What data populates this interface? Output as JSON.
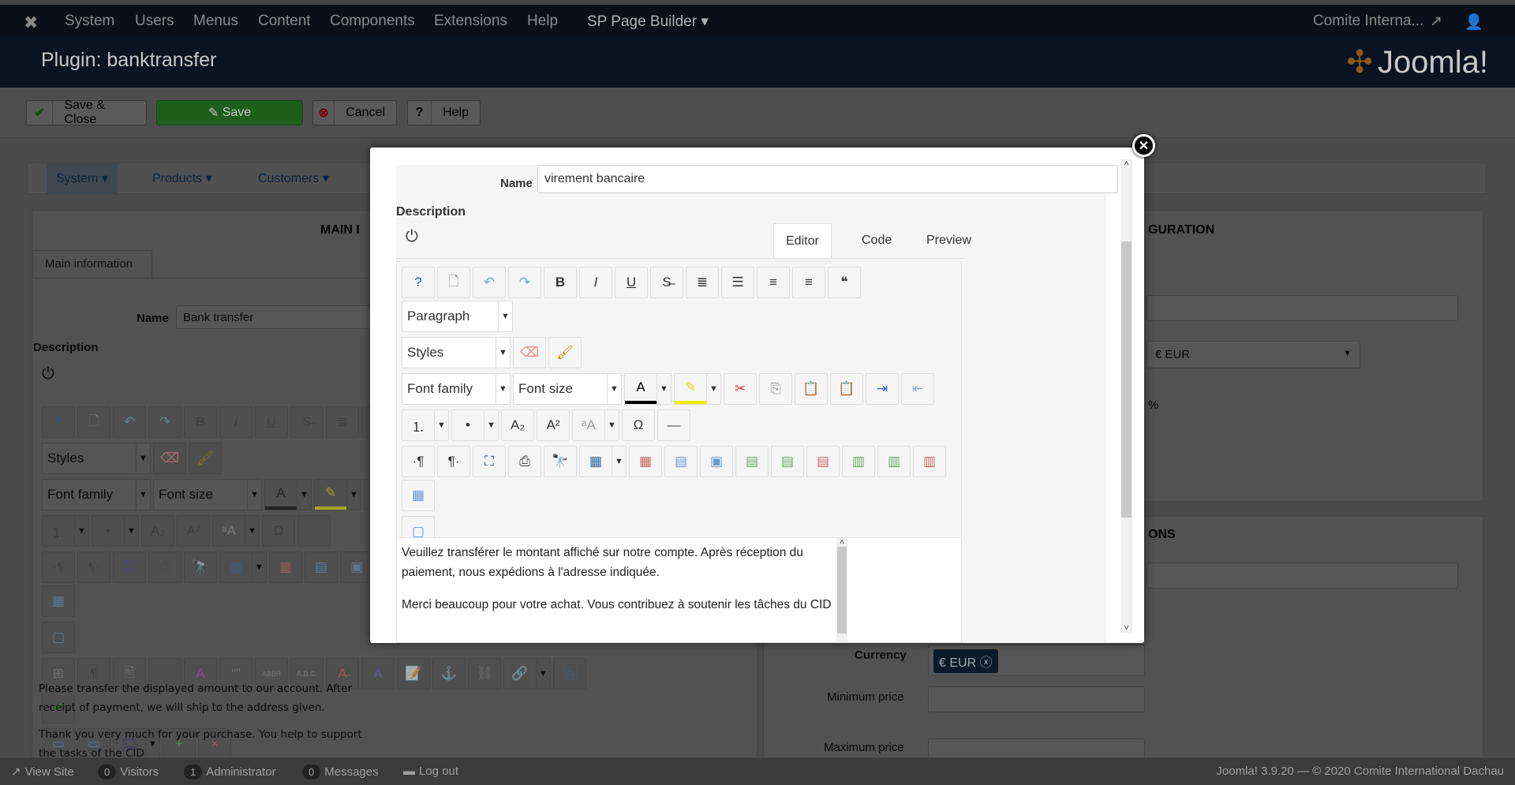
{
  "navbar": {
    "items": [
      "System",
      "Users",
      "Menus",
      "Content",
      "Components",
      "Extensions",
      "Help"
    ],
    "sp_page_builder": "SP Page Builder ▾",
    "site": "Comite Interna...",
    "logo": "Joomla!"
  },
  "header": {
    "title": "Plugin: banktransfer"
  },
  "toolbar": {
    "save_close": "Save & Close",
    "save": "Save",
    "cancel": "Cancel",
    "help": "Help"
  },
  "menutabs": {
    "system": "System ▾",
    "products": "Products ▾",
    "customers": "Customers ▾"
  },
  "bg_left": {
    "panel_title": "MAIN I",
    "tab": "Main information",
    "name_label": "Name",
    "name_value": "Bank transfer",
    "desc_label": "Description",
    "text1": "Please transfer the displayed amount to our account. After receipt of payment, we will ship to the address given.",
    "text2": "Thank you very much for your purchase. You help to support the tasks of the CID"
  },
  "bg_right": {
    "panel1_title": "GURATION",
    "currency_select": "€ EUR",
    "percent": "%",
    "panel2_title": "ONS",
    "currency_label": "Currency",
    "currency_chip": "€ EUR",
    "min_price": "Minimum price",
    "max_price": "Maximum price"
  },
  "footer": {
    "view_site": "View Site",
    "visitors_count": "0",
    "visitors": "Visitors",
    "admin_count": "1",
    "admin": "Administrator",
    "messages_count": "0",
    "messages": "Messages",
    "logout": "Log out",
    "version": "Joomla! 3.9.20 — © 2020 Comite International Dachau"
  },
  "modal": {
    "name_label": "Name",
    "name_value": "virement bancaire",
    "desc_label": "Description",
    "tabs": {
      "editor": "Editor",
      "code": "Code",
      "preview": "Preview"
    },
    "text1": "Veuillez transférer le montant affiché sur notre compte. Après réception du paiement, nous expédions à l'adresse indiquée.",
    "text2": "Merci beaucoup pour votre achat. Vous contribuez à soutenir les tâches du CID"
  },
  "editor_toolbar": [
    [
      {
        "icon": "help"
      },
      {
        "icon": "new-document"
      },
      {
        "icon": "undo"
      },
      {
        "icon": "redo"
      },
      {
        "icon": "bold"
      },
      {
        "icon": "italic"
      },
      {
        "icon": "underline"
      },
      {
        "icon": "strikethrough"
      },
      {
        "icon": "align-justify"
      },
      {
        "icon": "align-center"
      },
      {
        "icon": "align-left"
      },
      {
        "icon": "align-right"
      },
      {
        "icon": "blockquote"
      },
      {
        "select": "Paragraph",
        "w": 141
      }
    ],
    [
      {
        "select": "Styles",
        "w": 138
      },
      {
        "icon": "eraser"
      },
      {
        "icon": "brush"
      }
    ],
    [
      {
        "select": "Font family",
        "w": 138
      },
      {
        "select": "Font size",
        "w": 138
      },
      {
        "icon": "text-color",
        "split": true
      },
      {
        "icon": "highlight",
        "split": true
      },
      {
        "icon": "cut"
      },
      {
        "icon": "copy"
      },
      {
        "icon": "paste"
      },
      {
        "icon": "paste-text"
      },
      {
        "icon": "indent"
      },
      {
        "icon": "outdent"
      }
    ],
    [
      {
        "icon": "numbered-list",
        "split": true
      },
      {
        "icon": "bullet-list",
        "split": true
      },
      {
        "icon": "subscript"
      },
      {
        "icon": "superscript"
      },
      {
        "icon": "case",
        "split": true
      },
      {
        "icon": "omega"
      },
      {
        "icon": "horizontal-rule"
      }
    ],
    [
      {
        "icon": "ltr"
      },
      {
        "icon": "rtl"
      },
      {
        "icon": "fullscreen"
      },
      {
        "icon": "print"
      },
      {
        "icon": "find"
      },
      {
        "icon": "table",
        "split": true
      },
      {
        "icon": "delete-table"
      },
      {
        "icon": "row-props"
      },
      {
        "icon": "cell-props"
      },
      {
        "icon": "row-before"
      },
      {
        "icon": "row-after"
      },
      {
        "icon": "delete-row"
      },
      {
        "icon": "col-before"
      },
      {
        "icon": "col-after"
      },
      {
        "icon": "delete-col"
      },
      {
        "icon": "split-cells"
      }
    ],
    [
      {
        "icon": "merge-cells"
      }
    ],
    [
      {
        "icon": "visual-aid",
        "active": true
      },
      {
        "icon": "show-blocks"
      },
      {
        "icon": "pdf"
      },
      {
        "icon": "template"
      },
      {
        "icon": "style-props"
      },
      {
        "icon": "cite"
      },
      {
        "icon": "abbr"
      },
      {
        "icon": "acronym"
      },
      {
        "icon": "del"
      },
      {
        "icon": "ins"
      },
      {
        "icon": "attribs"
      },
      {
        "icon": "anchor"
      },
      {
        "icon": "unlink"
      },
      {
        "icon": "link",
        "split": true
      },
      {
        "icon": "image"
      },
      {
        "icon": "spellcheck"
      }
    ],
    [
      {
        "icon": "pagebreak"
      },
      {
        "icon": "readmore"
      },
      {
        "icon": "media",
        "split": true
      },
      {
        "icon": "add-file"
      },
      {
        "icon": "remove-file"
      }
    ]
  ],
  "colors": {
    "accent": "#245ea6",
    "save": "#2f9a2a",
    "chip": "#1a3a5c"
  }
}
